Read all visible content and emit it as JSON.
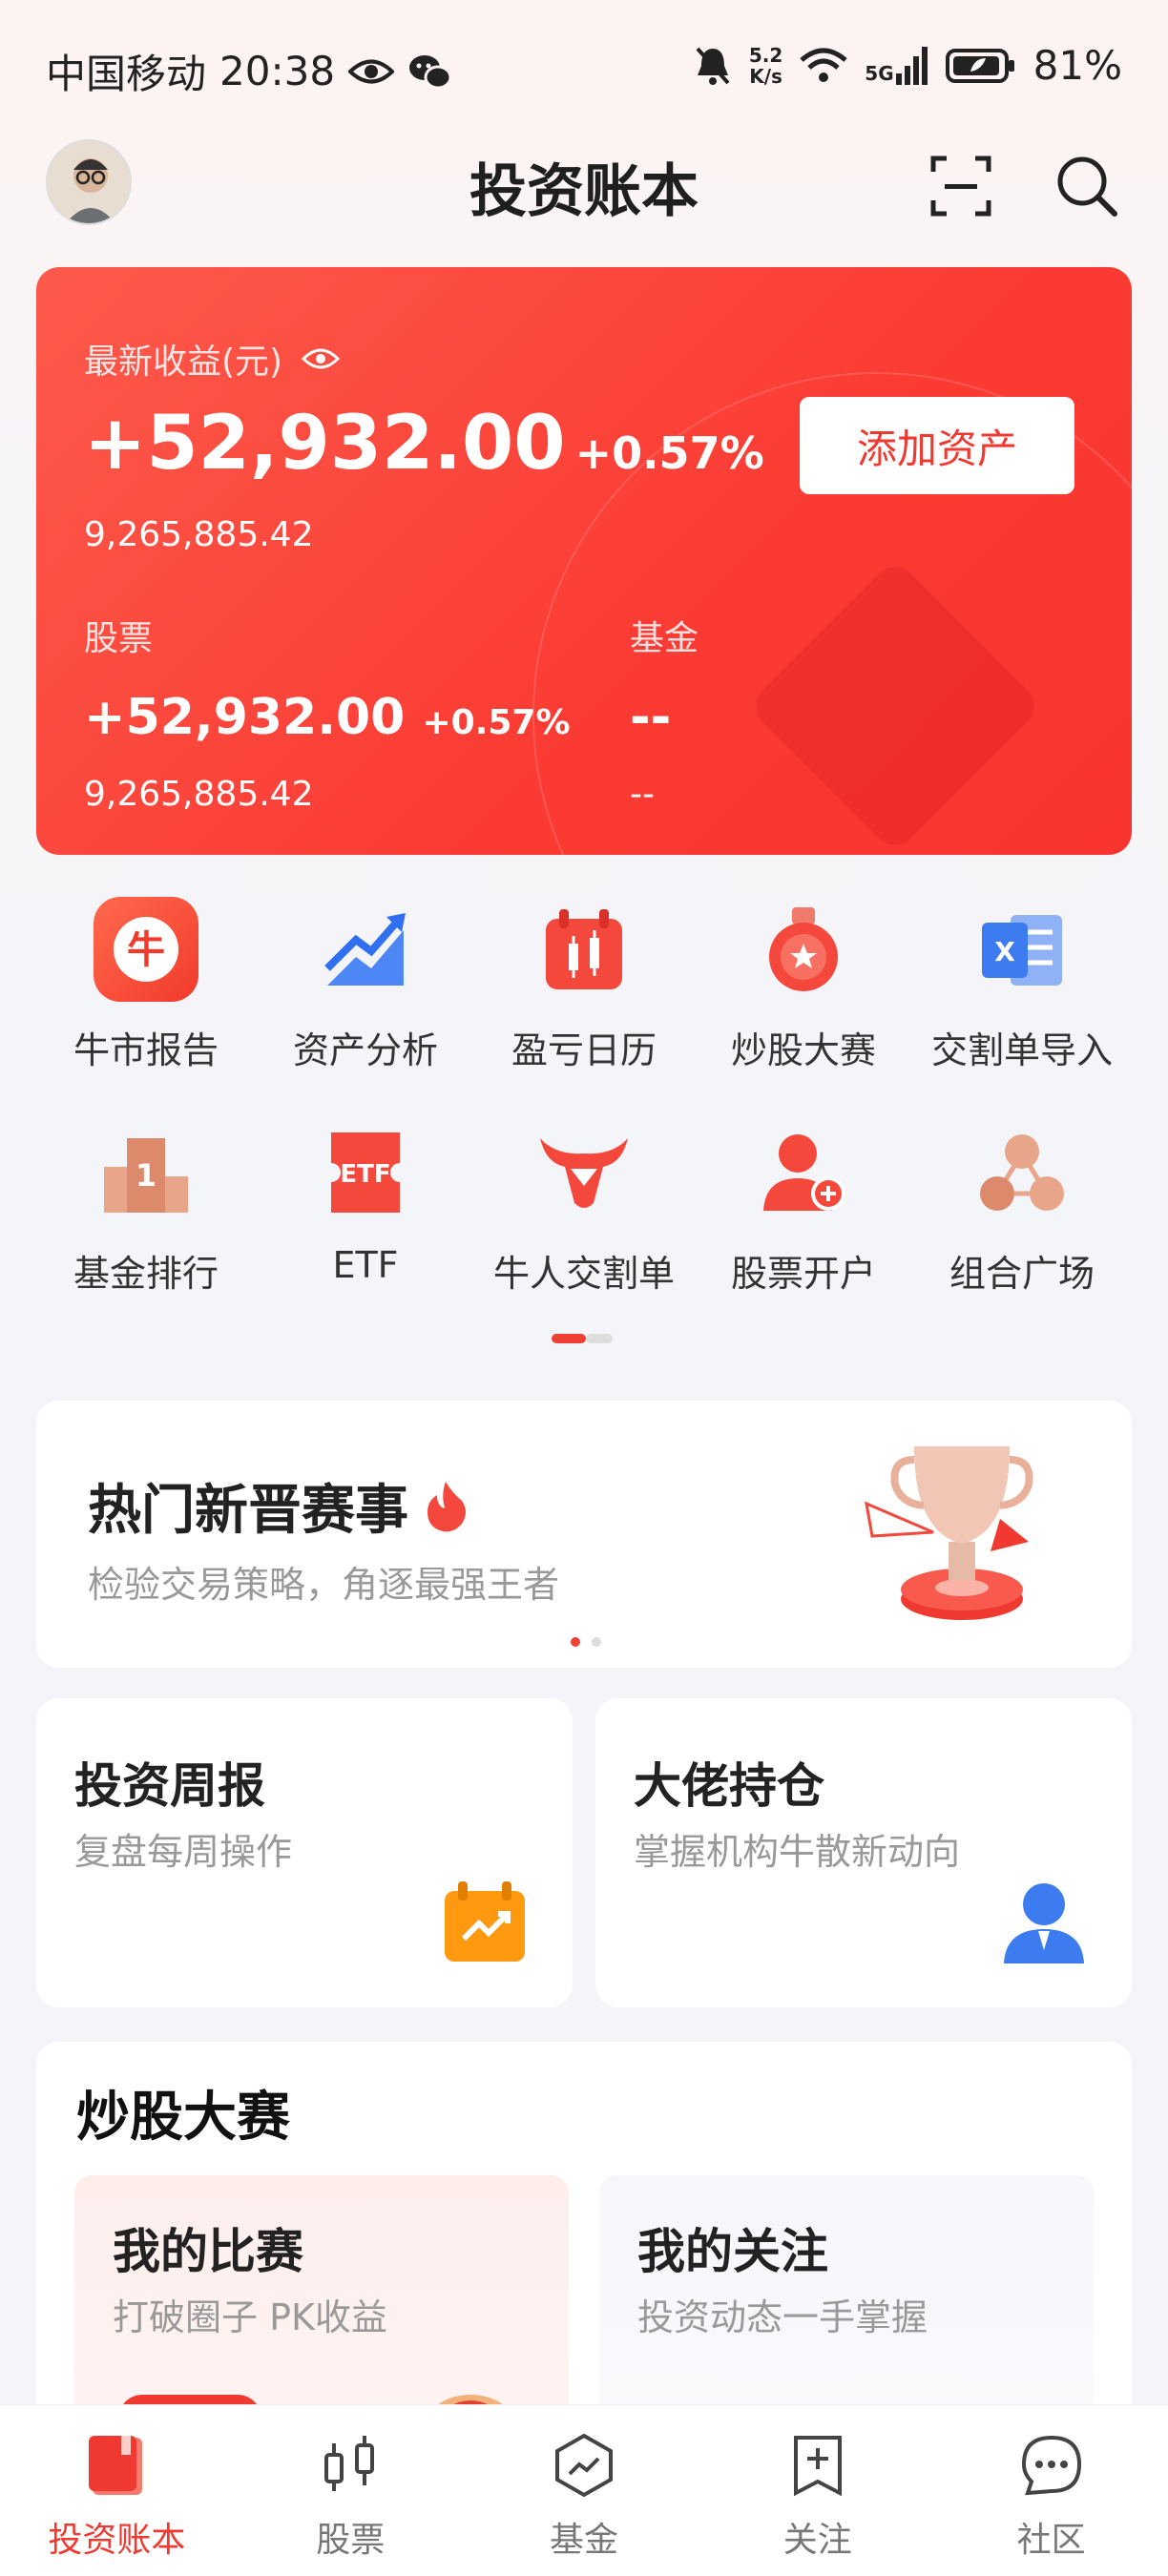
{
  "status_bar": {
    "carrier": "中国移动",
    "time": "20:38",
    "net_speed_top": "5.2",
    "net_speed_bottom": "K/s",
    "signal_label": "5G",
    "battery": "81%"
  },
  "header": {
    "title": "投资账本"
  },
  "hero": {
    "label": "最新收益(元)",
    "total_profit": "+52,932.00",
    "total_pct": "+0.57%",
    "total_assets": "9,265,885.42",
    "add_button": "添加资产",
    "stocks": {
      "label": "股票",
      "profit": "+52,932.00",
      "pct": "+0.57%",
      "assets": "9,265,885.42"
    },
    "funds": {
      "label": "基金",
      "profit": "--",
      "assets": "--"
    }
  },
  "shortcuts": [
    {
      "label": "牛市报告",
      "icon": "bull-report-icon"
    },
    {
      "label": "资产分析",
      "icon": "asset-analysis-icon"
    },
    {
      "label": "盈亏日历",
      "icon": "profit-calendar-icon"
    },
    {
      "label": "炒股大赛",
      "icon": "contest-medal-icon"
    },
    {
      "label": "交割单导入",
      "icon": "excel-import-icon"
    },
    {
      "label": "基金排行",
      "icon": "fund-ranking-icon"
    },
    {
      "label": "ETF",
      "icon": "etf-ticket-icon"
    },
    {
      "label": "牛人交割单",
      "icon": "bull-head-icon"
    },
    {
      "label": "股票开户",
      "icon": "open-account-icon"
    },
    {
      "label": "组合广场",
      "icon": "portfolio-plaza-icon"
    }
  ],
  "banner": {
    "title": "热门新晋赛事",
    "subtitle": "检验交易策略，角逐最强王者"
  },
  "cards": [
    {
      "title": "投资周报",
      "subtitle": "复盘每周操作"
    },
    {
      "title": "大佬持仓",
      "subtitle": "掌握机构牛散新动向"
    }
  ],
  "contest": {
    "title": "炒股大赛",
    "items": [
      {
        "title": "我的比赛",
        "subtitle": "打破圈子 PK收益"
      },
      {
        "title": "我的关注",
        "subtitle": "投资动态一手掌握"
      }
    ]
  },
  "bottom_nav": [
    {
      "label": "投资账本",
      "active": true
    },
    {
      "label": "股票",
      "active": false
    },
    {
      "label": "基金",
      "active": false
    },
    {
      "label": "关注",
      "active": false
    },
    {
      "label": "社区",
      "active": false
    }
  ],
  "colors": {
    "accent": "#f03a31",
    "hero_start": "#fd5a4b",
    "hero_end": "#f9342f"
  }
}
